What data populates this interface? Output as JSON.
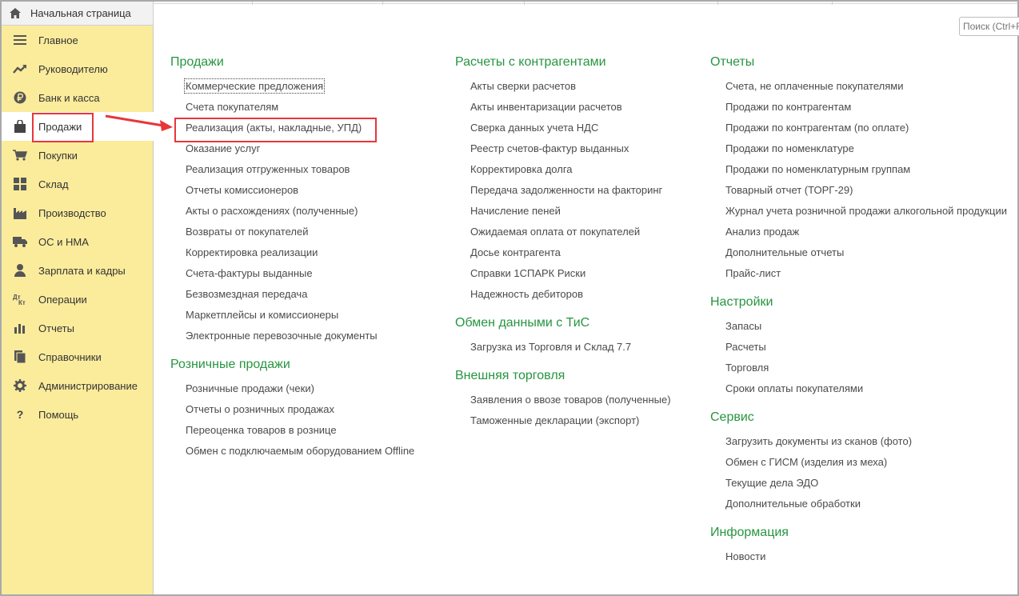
{
  "home_tab": {
    "label": "Начальная страница",
    "icon": "home-icon"
  },
  "search": {
    "placeholder": "Поиск (Ctrl+F)"
  },
  "sidebar": {
    "items": [
      {
        "label": "Главное",
        "icon": "menu-lines-icon"
      },
      {
        "label": "Руководителю",
        "icon": "trend-icon"
      },
      {
        "label": "Банк и касса",
        "icon": "ruble-icon"
      },
      {
        "label": "Продажи",
        "icon": "shopping-bag-icon",
        "active": true
      },
      {
        "label": "Покупки",
        "icon": "cart-icon"
      },
      {
        "label": "Склад",
        "icon": "warehouse-icon"
      },
      {
        "label": "Производство",
        "icon": "factory-icon"
      },
      {
        "label": "ОС и НМА",
        "icon": "truck-icon"
      },
      {
        "label": "Зарплата и кадры",
        "icon": "person-icon"
      },
      {
        "label": "Операции",
        "icon": "dt-kt-icon"
      },
      {
        "label": "Отчеты",
        "icon": "bar-chart-icon"
      },
      {
        "label": "Справочники",
        "icon": "books-icon"
      },
      {
        "label": "Администрирование",
        "icon": "gear-icon"
      },
      {
        "label": "Помощь",
        "icon": "question-icon"
      }
    ]
  },
  "col1": {
    "sections": [
      {
        "title": "Продажи",
        "links": [
          "Коммерческие предложения",
          "Счета покупателям",
          "Реализация (акты, накладные, УПД)",
          "Оказание услуг",
          "Реализация отгруженных товаров",
          "Отчеты комиссионеров",
          "Акты о расхождениях (полученные)",
          "Возвраты от покупателей",
          "Корректировка реализации",
          "Счета-фактуры выданные",
          "Безвозмездная передача",
          "Маркетплейсы и комиссионеры",
          "Электронные перевозочные документы"
        ]
      },
      {
        "title": "Розничные продажи",
        "links": [
          "Розничные продажи (чеки)",
          "Отчеты о розничных продажах",
          "Переоценка товаров в рознице",
          "Обмен с подключаемым оборудованием Offline"
        ]
      }
    ]
  },
  "col2": {
    "sections": [
      {
        "title": "Расчеты с контрагентами",
        "links": [
          "Акты сверки расчетов",
          "Акты инвентаризации расчетов",
          "Сверка данных учета НДС",
          "Реестр счетов-фактур выданных",
          "Корректировка долга",
          "Передача задолженности на факторинг",
          "Начисление пеней",
          "Ожидаемая оплата от покупателей",
          "Досье контрагента",
          "Справки 1СПАРК Риски",
          "Надежность дебиторов"
        ]
      },
      {
        "title": "Обмен данными с ТиС",
        "links": [
          "Загрузка из Торговля и Склад 7.7"
        ]
      },
      {
        "title": "Внешняя торговля",
        "links": [
          "Заявления о ввозе товаров (полученные)",
          "Таможенные декларации (экспорт)"
        ]
      }
    ]
  },
  "col3": {
    "sections": [
      {
        "title": "Отчеты",
        "links": [
          "Счета, не оплаченные покупателями",
          "Продажи по контрагентам",
          "Продажи по контрагентам (по оплате)",
          "Продажи по номенклатуре",
          "Продажи по номенклатурным группам",
          "Товарный отчет (ТОРГ-29)",
          "Журнал учета розничной продажи алкогольной продукции",
          "Анализ продаж",
          "Дополнительные отчеты",
          "Прайс-лист"
        ]
      },
      {
        "title": "Настройки",
        "links": [
          "Запасы",
          "Расчеты",
          "Торговля",
          "Сроки оплаты покупателями"
        ]
      },
      {
        "title": "Сервис",
        "links": [
          "Загрузить документы из сканов (фото)",
          "Обмен с ГИСМ (изделия из меха)",
          "Текущие дела ЭДО",
          "Дополнительные обработки"
        ]
      },
      {
        "title": "Информация",
        "links": [
          "Новости"
        ]
      }
    ]
  },
  "colors": {
    "sidebar_bg": "#fbec9c",
    "section_title": "#279541",
    "highlight": "#e8363a"
  }
}
